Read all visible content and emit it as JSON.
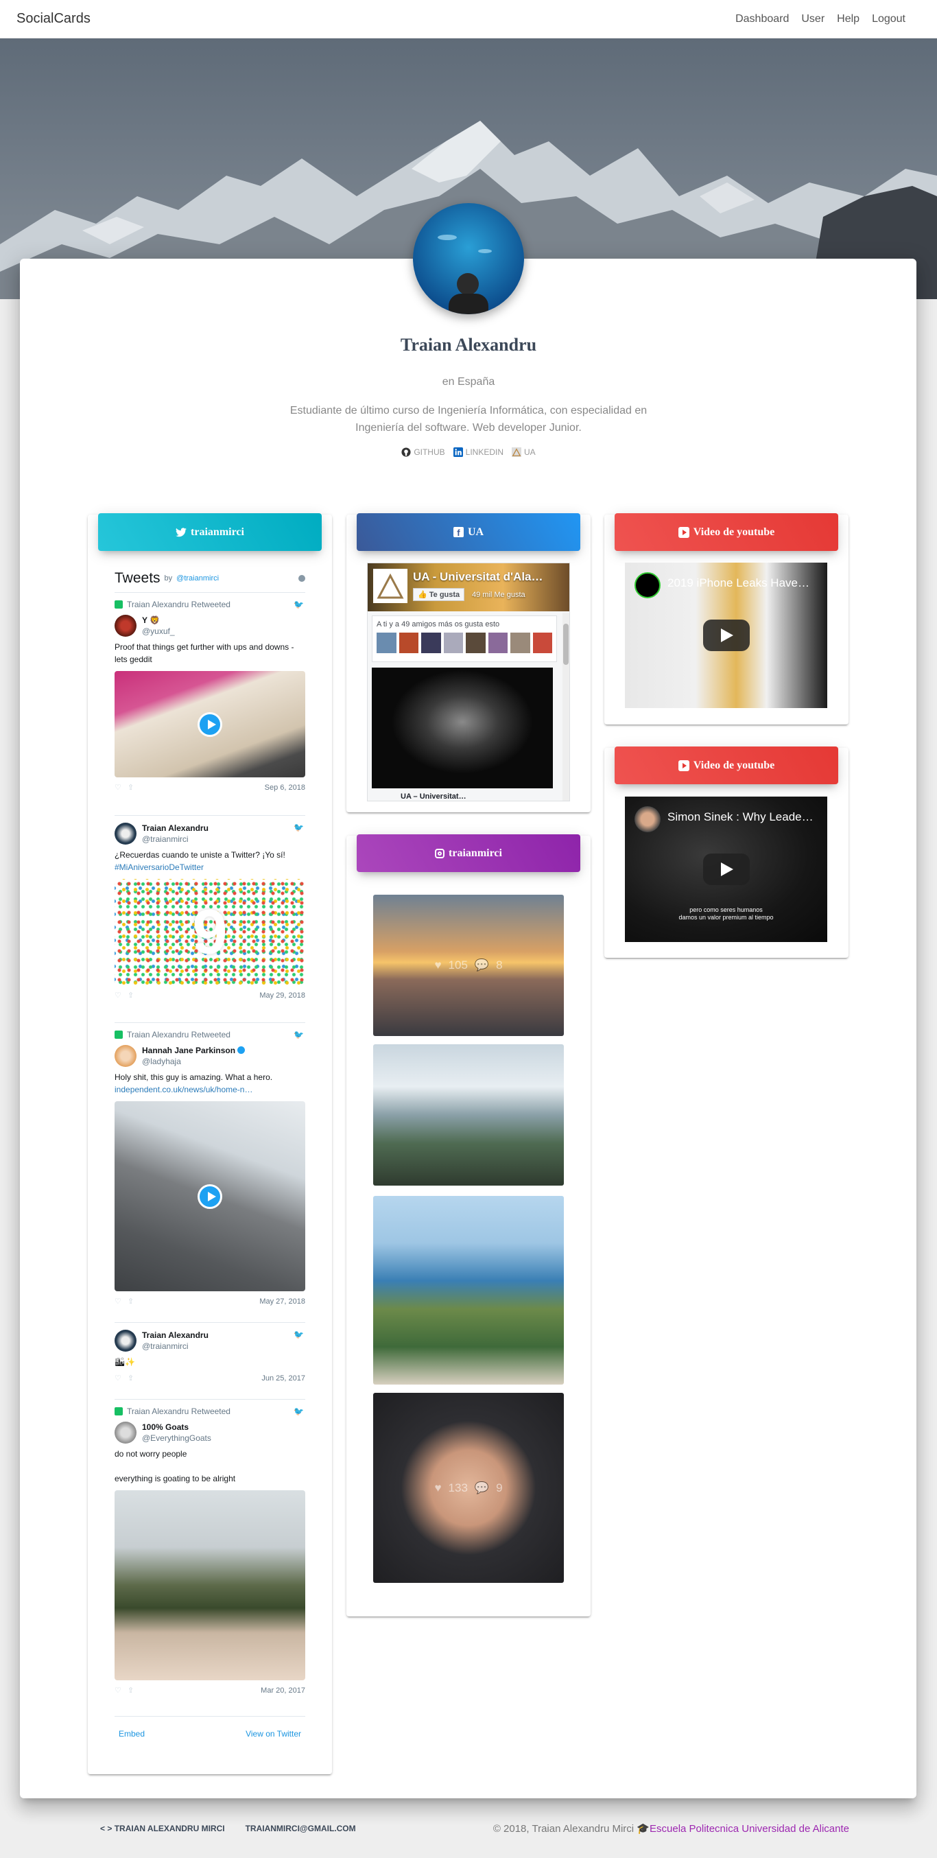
{
  "nav": {
    "brand": "SocialCards",
    "links": [
      "Dashboard",
      "User",
      "Help",
      "Logout"
    ]
  },
  "profile": {
    "name": "Traian Alexandru",
    "location": "en España",
    "description": "Estudiante de último curso de Ingeniería Informática, con especialidad en Ingeniería del software. Web developer Junior.",
    "links": {
      "github": "GITHUB",
      "linkedin": "LINKEDIN",
      "ua": "UA"
    }
  },
  "twitter": {
    "header": "traianmirci",
    "title": "Tweets",
    "by": "by",
    "handle": "@traianmirci",
    "tweets": [
      {
        "retweet": "Traian Alexandru Retweeted",
        "author": "Y 🦁",
        "handle": "@yuxuf_",
        "text": "Proof that things get further with ups and downs - lets geddit",
        "date": "Sep 6, 2018"
      },
      {
        "retweet": "",
        "author": "Traian Alexandru",
        "handle": "@traianmirci",
        "text": "¿Recuerdas cuando te uniste a Twitter? ¡Yo sí!",
        "link": "#MiAniversarioDeTwitter",
        "date": "May 29, 2018"
      },
      {
        "retweet": "Traian Alexandru Retweeted",
        "author": "Hannah Jane Parkinson",
        "handle": "@ladyhaja",
        "text": "Holy shit, this guy is amazing. What a hero.",
        "link": "independent.co.uk/news/uk/home-n…",
        "date": "May 27, 2018"
      },
      {
        "retweet": "",
        "author": "Traian Alexandru",
        "handle": "@traianmirci",
        "text": "🏙✨",
        "date": "Jun 25, 2017"
      },
      {
        "retweet": "Traian Alexandru Retweeted",
        "author": "100% Goats",
        "handle": "@EverythingGoats",
        "text": "do not worry people",
        "text2": "everything is goating to be alright",
        "date": "Mar 20, 2017"
      }
    ],
    "embed": "Embed",
    "view": "View on Twitter"
  },
  "facebook": {
    "header": "UA",
    "page_title": "UA - Universitat d'Ala…",
    "like_button": "Te gusta",
    "likes": "49 mil Me gusta",
    "friends_text": "A ti y a 49 amigos más os gusta esto",
    "post_title": "UA – Universitat…"
  },
  "instagram": {
    "header": "traianmirci",
    "posts": [
      {
        "likes": "105",
        "comments": "8"
      },
      {
        "likes": "",
        "comments": ""
      },
      {
        "likes": "",
        "comments": ""
      },
      {
        "likes": "133",
        "comments": "9"
      }
    ]
  },
  "youtube": [
    {
      "header": "Video de youtube",
      "title": "2019 iPhone Leaks Have…"
    },
    {
      "header": "Video de youtube",
      "title": "Simon Sinek : Why Leade…",
      "caption_1": "pero como seres humanos",
      "caption_2": "damos un valor premium al tiempo"
    }
  ],
  "footer": {
    "name": "TRAIAN ALEXANDRU MIRCI",
    "email": "TRAIANMIRCI@GMAIL.COM",
    "copyright": "© 2018, Traian Alexandru Mirci",
    "school": "Escuela Politecnica Universidad de Alicante"
  },
  "colors": {
    "twitter": "#00acc1",
    "facebook": "#2196f3",
    "instagram": "#8e24aa",
    "youtube": "#e53935",
    "school_link": "#9c27b0"
  }
}
